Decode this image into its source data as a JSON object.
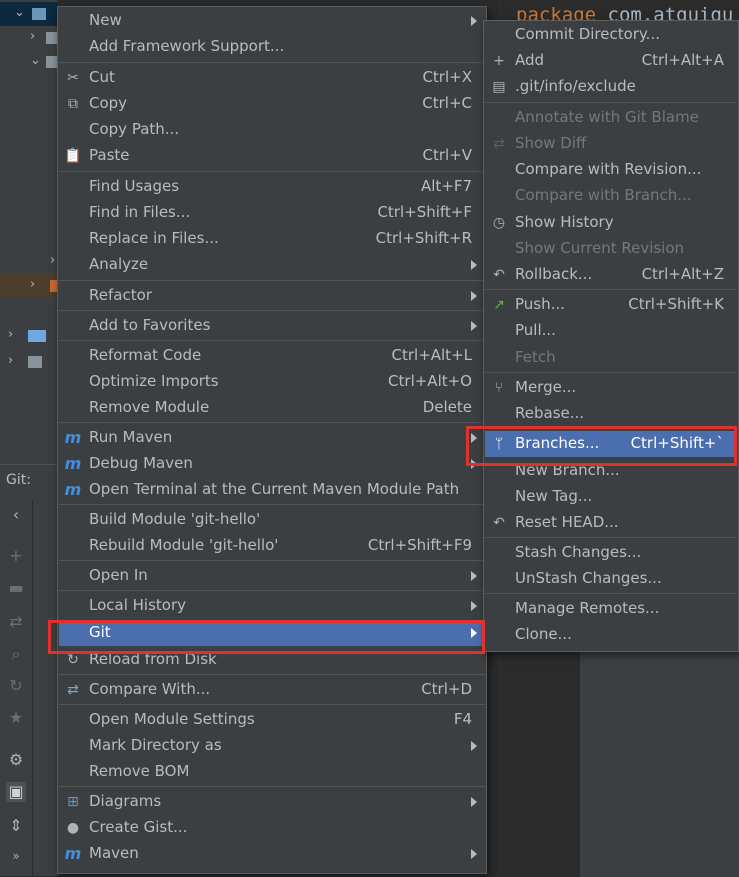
{
  "editor": {
    "code_keyword": "package",
    "code_rest": " com.atguigu"
  },
  "tool_window": {
    "git_label": "Git:"
  },
  "context_menu": {
    "items": [
      {
        "label": "New",
        "submenu": true
      },
      {
        "label": "Add Framework Support..."
      },
      {
        "label": "Cut",
        "shortcut": "Ctrl+X",
        "icon": "cut-icon"
      },
      {
        "label": "Copy",
        "shortcut": "Ctrl+C",
        "icon": "copy-icon"
      },
      {
        "label": "Copy Path..."
      },
      {
        "label": "Paste",
        "shortcut": "Ctrl+V",
        "icon": "paste-icon"
      },
      {
        "label": "Find Usages",
        "shortcut": "Alt+F7"
      },
      {
        "label": "Find in Files...",
        "shortcut": "Ctrl+Shift+F"
      },
      {
        "label": "Replace in Files...",
        "shortcut": "Ctrl+Shift+R"
      },
      {
        "label": "Analyze",
        "submenu": true
      },
      {
        "label": "Refactor",
        "submenu": true
      },
      {
        "label": "Add to Favorites",
        "submenu": true
      },
      {
        "label": "Reformat Code",
        "shortcut": "Ctrl+Alt+L"
      },
      {
        "label": "Optimize Imports",
        "shortcut": "Ctrl+Alt+O"
      },
      {
        "label": "Remove Module",
        "shortcut": "Delete"
      },
      {
        "label": "Run Maven",
        "submenu": true,
        "icon": "maven-run-icon"
      },
      {
        "label": "Debug Maven",
        "submenu": true,
        "icon": "maven-debug-icon"
      },
      {
        "label": "Open Terminal at the Current Maven Module Path",
        "icon": "maven-terminal-icon"
      },
      {
        "label": "Build Module 'git-hello'"
      },
      {
        "label": "Rebuild Module 'git-hello'",
        "shortcut": "Ctrl+Shift+F9"
      },
      {
        "label": "Open In",
        "submenu": true
      },
      {
        "label": "Local History",
        "submenu": true
      },
      {
        "label": "Git",
        "submenu": true,
        "highlighted": true
      },
      {
        "label": "Reload from Disk",
        "icon": "reload-icon"
      },
      {
        "label": "Compare With...",
        "shortcut": "Ctrl+D",
        "icon": "compare-icon"
      },
      {
        "label": "Open Module Settings",
        "shortcut": "F4"
      },
      {
        "label": "Mark Directory as",
        "submenu": true
      },
      {
        "label": "Remove BOM"
      },
      {
        "label": "Diagrams",
        "submenu": true,
        "icon": "diagram-icon"
      },
      {
        "label": "Create Gist...",
        "icon": "github-icon"
      },
      {
        "label": "Maven",
        "submenu": true,
        "icon": "maven-icon"
      }
    ]
  },
  "git_submenu": {
    "items": [
      {
        "label": "Commit Directory..."
      },
      {
        "label": "Add",
        "shortcut": "Ctrl+Alt+A",
        "icon": "plus-icon"
      },
      {
        "label": ".git/info/exclude",
        "icon": "git-file-icon"
      },
      {
        "label": "Annotate with Git Blame",
        "disabled": true
      },
      {
        "label": "Show Diff",
        "disabled": true,
        "icon": "diff-icon"
      },
      {
        "label": "Compare with Revision..."
      },
      {
        "label": "Compare with Branch...",
        "disabled": true
      },
      {
        "label": "Show History",
        "icon": "history-icon"
      },
      {
        "label": "Show Current Revision",
        "disabled": true
      },
      {
        "label": "Rollback...",
        "shortcut": "Ctrl+Alt+Z",
        "icon": "rollback-icon"
      },
      {
        "label": "Push...",
        "shortcut": "Ctrl+Shift+K",
        "icon": "push-icon"
      },
      {
        "label": "Pull..."
      },
      {
        "label": "Fetch",
        "disabled": true
      },
      {
        "label": "Merge...",
        "icon": "merge-icon"
      },
      {
        "label": "Rebase..."
      },
      {
        "label": "Branches...",
        "shortcut": "Ctrl+Shift+`",
        "highlighted": true,
        "icon": "branch-icon"
      },
      {
        "label": "New Branch..."
      },
      {
        "label": "New Tag..."
      },
      {
        "label": "Reset HEAD...",
        "icon": "reset-icon"
      },
      {
        "label": "Stash Changes..."
      },
      {
        "label": "UnStash Changes..."
      },
      {
        "label": "Manage Remotes..."
      },
      {
        "label": "Clone..."
      }
    ]
  },
  "colors": {
    "menu_bg": "#3c3f41",
    "highlight": "#4b6eaf",
    "callout": "#e0312e",
    "text": "#bbbbbb",
    "disabled_text": "#777777"
  }
}
